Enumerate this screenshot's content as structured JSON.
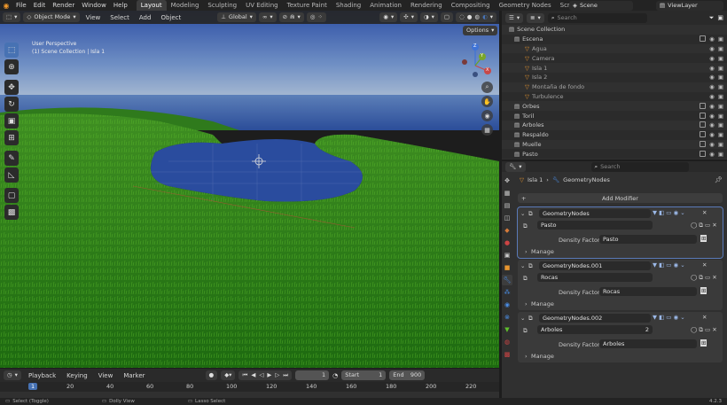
{
  "menu": {
    "items": [
      "File",
      "Edit",
      "Render",
      "Window",
      "Help"
    ]
  },
  "workspaces": [
    "Layout",
    "Modeling",
    "Sculpting",
    "UV Editing",
    "Texture Paint",
    "Shading",
    "Animation",
    "Rendering",
    "Compositing",
    "Geometry Nodes",
    "Scripting"
  ],
  "scene": {
    "name": "Scene",
    "view_layer": "ViewLayer"
  },
  "viewport": {
    "mode": "Object Mode",
    "menus": [
      "View",
      "Select",
      "Add",
      "Object"
    ],
    "transform": "Global",
    "options": "Options",
    "overlay_title": "User Perspective",
    "overlay_sub": "(1) Scene Collection | Isla 1",
    "gizmo": {
      "x": "X",
      "y": "Y",
      "z": "Z"
    }
  },
  "outliner": {
    "search_placeholder": "Search",
    "root": "Scene Collection",
    "rows": [
      {
        "label": "Escena",
        "indent": 1
      },
      {
        "label": "Agua",
        "indent": 2
      },
      {
        "label": "Camera",
        "indent": 2
      },
      {
        "label": "Isla 1",
        "indent": 2
      },
      {
        "label": "Isla 2",
        "indent": 2
      },
      {
        "label": "Montaña de fondo",
        "indent": 2
      },
      {
        "label": "Turbulence",
        "indent": 2
      },
      {
        "label": "Orbes",
        "indent": 0
      },
      {
        "label": "Toril",
        "indent": 0
      },
      {
        "label": "Arboles",
        "indent": 0
      },
      {
        "label": "Respaldo",
        "indent": 0
      },
      {
        "label": "Muelle",
        "indent": 0
      },
      {
        "label": "Pasto",
        "indent": 0
      }
    ]
  },
  "properties": {
    "search_placeholder": "Search",
    "object": "Isla 1",
    "modifier_type": "GeometryNodes",
    "add_modifier": "Add Modifier",
    "modifiers": [
      {
        "name": "GeometryNodes",
        "group": "Pasto",
        "density_label": "Density Factor",
        "density_value": "Pasto",
        "user_count": "",
        "manage": "Manage"
      },
      {
        "name": "GeometryNodes.001",
        "group": "Rocas",
        "density_label": "Density Factor",
        "density_value": "Rocas",
        "user_count": "",
        "manage": "Manage"
      },
      {
        "name": "GeometryNodes.002",
        "group": "Arboles",
        "density_label": "Density Factor",
        "density_value": "Arboles",
        "user_count": "2",
        "manage": "Manage"
      }
    ]
  },
  "timeline": {
    "menus": [
      "Playback",
      "Keying",
      "View",
      "Marker"
    ],
    "current_frame": "1",
    "start_label": "Start",
    "start": "1",
    "end_label": "End",
    "end": "900",
    "ruler": [
      "1",
      "20",
      "40",
      "60",
      "80",
      "100",
      "120",
      "140",
      "160",
      "180",
      "200",
      "220"
    ]
  },
  "status": {
    "select": "Select (Toggle)",
    "dolly": "Dolly View",
    "lasso": "Lasso Select",
    "version": "4.2.3"
  },
  "colors": {
    "accent": "#4772b3",
    "grass": "#2f7a1c",
    "water": "#3a5fa8",
    "sky_top": "#2d4fa5",
    "sky_horizon": "#b9c7d6"
  }
}
